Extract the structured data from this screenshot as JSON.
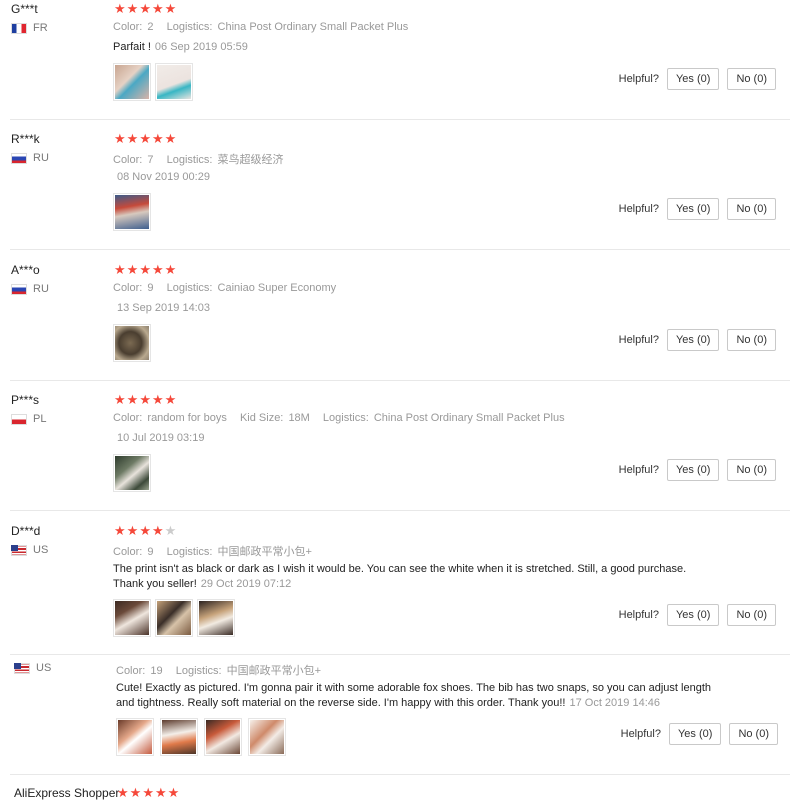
{
  "labels": {
    "color": "Color:",
    "logistics": "Logistics:",
    "kid_size": "Kid Size:",
    "helpful": "Helpful?",
    "yes": "Yes (0)",
    "no": "No (0)"
  },
  "reviews": [
    {
      "user": "G***t",
      "country": "FR",
      "rating": 5,
      "color": "2",
      "logistics": "China Post Ordinary Small Packet Plus",
      "text": "Parfait !",
      "date": "06 Sep 2019 05:59",
      "photos": 2
    },
    {
      "user": "R***k",
      "country": "RU",
      "rating": 5,
      "color": "7",
      "logistics": "菜鸟超级经济",
      "text": "",
      "date": "08 Nov 2019 00:29",
      "photos": 1
    },
    {
      "user": "A***o",
      "country": "RU",
      "rating": 5,
      "color": "9",
      "logistics": "Cainiao Super Economy",
      "text": "",
      "date": "13 Sep 2019 14:03",
      "photos": 1
    },
    {
      "user": "P***s",
      "country": "PL",
      "rating": 5,
      "color": "random for boys",
      "kid_size": "18M",
      "logistics": "China Post Ordinary Small Packet Plus",
      "text": "",
      "date": "10 Jul 2019 03:19",
      "photos": 1
    },
    {
      "user": "D***d",
      "country": "US",
      "rating": 4,
      "color": "9",
      "logistics": "中国邮政平常小包+",
      "text_line1": "The print isn't as black or dark as I wish it would be. You can see the white when it is stretched. Still, a good purchase.",
      "text_line2": "Thank you seller!",
      "date": "29 Oct 2019 07:12",
      "photos": 3
    },
    {
      "user": "",
      "country": "US",
      "rating": 0,
      "color": "19",
      "logistics": "中国邮政平常小包+",
      "text_line1": "Cute! Exactly as pictured. I'm gonna pair it with some adorable fox shoes. The bib has two snaps, so you can adjust length",
      "text_line2": "and tightness. Really soft material on the reverse side. I'm happy with this order. Thank you!!",
      "date": "17 Oct 2019 14:46",
      "photos": 4
    },
    {
      "user": "AliExpress Shopper",
      "rating": 5
    }
  ],
  "colors": {
    "star": "#f5483a",
    "star_off": "#cccccc"
  },
  "icons": {
    "star": "★"
  }
}
